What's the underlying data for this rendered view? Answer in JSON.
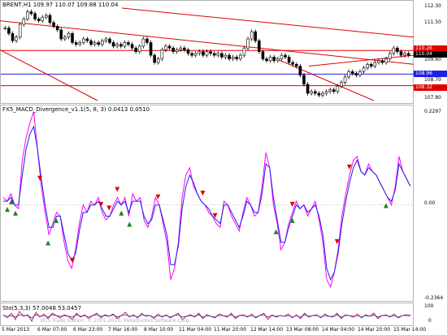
{
  "chart_data": [
    {
      "type": "candlestick",
      "title": "BRENT,H1  109.97 110.07 109.88 110.04",
      "ylim": [
        107.5,
        112.6
      ],
      "y_ticks": [
        "112.30",
        "111.50",
        "110.26",
        "110.04",
        "109.60",
        "108.96",
        "108.70",
        "108.32",
        "107.80"
      ],
      "current_price": "110.04",
      "levels": [
        {
          "value": "110.26",
          "color": "#e00000"
        },
        {
          "value": "108.96",
          "color": "#2020e0"
        },
        {
          "value": "108.32",
          "color": "#e00000"
        }
      ],
      "closes": [
        111.5,
        111.2,
        110.8,
        111.0,
        111.7,
        112.0,
        112.4,
        112.3,
        112.0,
        111.9,
        112.1,
        112.2,
        111.8,
        111.6,
        111.4,
        110.9,
        111.0,
        111.2,
        110.7,
        110.6,
        110.7,
        110.9,
        110.8,
        110.6,
        110.7,
        110.6,
        110.8,
        110.9,
        110.7,
        110.5,
        110.6,
        110.5,
        110.7,
        110.6,
        110.4,
        110.2,
        110.5,
        110.9,
        110.7,
        110.0,
        109.6,
        109.8,
        110.3,
        110.5,
        110.4,
        110.2,
        110.3,
        110.4,
        110.3,
        110.1,
        110.0,
        110.1,
        110.2,
        110.0,
        110.2,
        110.1,
        110.0,
        110.1,
        109.9,
        110.0,
        109.8,
        109.9,
        109.8,
        110.0,
        110.4,
        110.9,
        111.3,
        110.8,
        110.2,
        109.8,
        109.7,
        109.9,
        109.7,
        109.8,
        110.0,
        109.9,
        109.6,
        109.5,
        109.4,
        108.9,
        108.4,
        107.9,
        108.0,
        107.9,
        107.8,
        107.9,
        108.0,
        108.1,
        108.0,
        108.3,
        108.5,
        108.8,
        109.1,
        109.0,
        108.9,
        109.1,
        109.3,
        109.5,
        109.4,
        109.6,
        109.7,
        109.6,
        109.8,
        110.1,
        110.4,
        110.2,
        110.0,
        110.1,
        110.0
      ],
      "trendlines": [
        {
          "p": [
            0,
            110.04
          ],
          "q": [
            1,
            110.04
          ],
          "color": "#e00000"
        }
      ]
    },
    {
      "type": "line",
      "title": "FX5_MACD_Divergence_v1.1(5, 8, 3) 0.0413 0.0510",
      "ylim": [
        -0.255,
        0.245
      ],
      "y_ticks": [
        "0.2297",
        "0.00",
        "-0.2364"
      ],
      "series": [
        {
          "color": "#ff00ff",
          "values": [
            0.02,
            0.01,
            0.03,
            0.0,
            -0.01,
            0.12,
            0.18,
            0.22,
            0.25,
            0.15,
            0.05,
            -0.02,
            -0.08,
            -0.05,
            -0.02,
            -0.03,
            -0.1,
            -0.15,
            -0.17,
            -0.12,
            -0.05,
            0.0,
            -0.02,
            0.01,
            0.0,
            0.02,
            -0.02,
            -0.04,
            -0.03,
            0.0,
            0.02,
            0.0,
            0.02,
            -0.03,
            0.03,
            0.01,
            0.02,
            -0.04,
            -0.06,
            -0.03,
            0.02,
            0.0,
            -0.05,
            -0.1,
            -0.2,
            -0.17,
            -0.1,
            0.02,
            0.08,
            0.1,
            0.05,
            0.03,
            0.01,
            0.0,
            -0.02,
            -0.03,
            -0.05,
            -0.06,
            0.01,
            0.0,
            -0.03,
            -0.05,
            -0.07,
            -0.02,
            0.02,
            0.0,
            -0.03,
            -0.02,
            0.05,
            0.14,
            0.1,
            0.0,
            -0.05,
            -0.12,
            -0.1,
            -0.05,
            -0.02,
            0.01,
            -0.01,
            0.0,
            -0.03,
            -0.01,
            0.01,
            -0.04,
            -0.1,
            -0.2,
            -0.22,
            -0.18,
            -0.12,
            -0.03,
            0.03,
            0.08,
            0.12,
            0.13,
            0.09,
            0.08,
            0.11,
            0.09,
            0.08,
            0.06,
            0.04,
            0.02,
            0.0,
            0.05,
            0.13,
            0.09,
            0.07,
            0.05
          ]
        },
        {
          "color": "#2020e0",
          "values": [
            0.01,
            0.01,
            0.02,
            0.0,
            0.0,
            0.08,
            0.15,
            0.19,
            0.21,
            0.15,
            0.07,
            0.0,
            -0.06,
            -0.06,
            -0.03,
            -0.03,
            -0.08,
            -0.13,
            -0.15,
            -0.13,
            -0.07,
            -0.02,
            -0.02,
            0.0,
            0.0,
            0.01,
            -0.01,
            -0.03,
            -0.03,
            -0.01,
            0.01,
            0.0,
            0.01,
            -0.02,
            0.01,
            0.01,
            0.01,
            -0.03,
            -0.05,
            -0.04,
            0.0,
            0.0,
            -0.04,
            -0.08,
            -0.16,
            -0.16,
            -0.11,
            -0.01,
            0.05,
            0.08,
            0.06,
            0.03,
            0.01,
            0.0,
            -0.01,
            -0.03,
            -0.04,
            -0.05,
            0.0,
            0.0,
            -0.02,
            -0.04,
            -0.06,
            -0.03,
            0.01,
            0.0,
            -0.02,
            -0.02,
            0.03,
            0.11,
            0.1,
            0.02,
            -0.04,
            -0.1,
            -0.1,
            -0.06,
            -0.03,
            0.0,
            -0.01,
            0.0,
            -0.02,
            -0.01,
            0.0,
            -0.03,
            -0.08,
            -0.17,
            -0.2,
            -0.18,
            -0.13,
            -0.05,
            0.01,
            0.06,
            0.1,
            0.12,
            0.09,
            0.08,
            0.1,
            0.09,
            0.08,
            0.06,
            0.04,
            0.02,
            0.01,
            0.04,
            0.11,
            0.09,
            0.07,
            0.05
          ]
        }
      ]
    },
    {
      "type": "line",
      "title": "Sto(5,3,3) 57.0048 53.0457",
      "ylim": [
        0,
        100
      ],
      "series": [
        {
          "color": "#e00000",
          "values": [
            60,
            40,
            70,
            30,
            80,
            50,
            60,
            20,
            75,
            45,
            65,
            35,
            70,
            55,
            40,
            60,
            50,
            30,
            70,
            45,
            60,
            35,
            55,
            70,
            40,
            60,
            50,
            65,
            35,
            55,
            75,
            45,
            60,
            40,
            70,
            50,
            55,
            35,
            65,
            45,
            60,
            40,
            55,
            70,
            30,
            50,
            60,
            45,
            70,
            35,
            60,
            50,
            40,
            65,
            55,
            45,
            70,
            35,
            55,
            60,
            45,
            65,
            40,
            55,
            70,
            30,
            60,
            45,
            55,
            50,
            65,
            40,
            60,
            35,
            70,
            45,
            55,
            60,
            40,
            65,
            50,
            45,
            70,
            35,
            60,
            55,
            45,
            65,
            40,
            60,
            50,
            70,
            35,
            55,
            60,
            45,
            65,
            40,
            55,
            60,
            57
          ]
        },
        {
          "color": "#2020e0",
          "values": [
            55,
            50,
            55,
            45,
            60,
            55,
            55,
            40,
            60,
            50,
            55,
            45,
            60,
            55,
            50,
            55,
            50,
            45,
            60,
            50,
            55,
            45,
            55,
            60,
            50,
            55,
            50,
            60,
            45,
            55,
            60,
            50,
            55,
            45,
            60,
            55,
            55,
            45,
            55,
            50,
            55,
            45,
            55,
            60,
            45,
            50,
            55,
            50,
            60,
            45,
            55,
            50,
            45,
            55,
            55,
            50,
            60,
            45,
            55,
            55,
            50,
            55,
            45,
            55,
            60,
            45,
            55,
            50,
            55,
            50,
            55,
            45,
            55,
            45,
            60,
            50,
            55,
            55,
            45,
            55,
            50,
            50,
            60,
            45,
            55,
            55,
            50,
            55,
            45,
            55,
            50,
            60,
            45,
            55,
            55,
            50,
            55,
            45,
            55,
            55,
            53
          ]
        }
      ]
    }
  ],
  "scale": {
    "macd_mid": "0.00",
    "sto_top": "100",
    "sto_bot": "0"
  },
  "x_axis": [
    "5 Mar 2013",
    "6 Mar 07:00",
    "6 Mar 23:00",
    "7 Mar 16:00",
    "8 Mar 10:00",
    "11 Mar 04:00",
    "11 Mar 20:00",
    "12 Mar 14:00",
    "13 Mar 08:00",
    "14 Mar 04:00",
    "14 Mar 20:00",
    "15 Mar 14:00"
  ],
  "watermark": "BCS Trade Station, © 2001-2013, MetaQuotes Software Corp."
}
